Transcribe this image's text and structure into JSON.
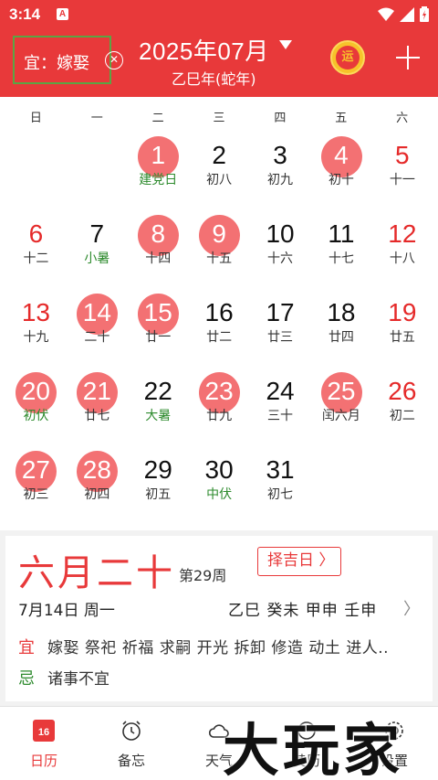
{
  "status_bar": {
    "time": "3:14",
    "app_badge": "A"
  },
  "header": {
    "yi_label": "宜：嫁娶",
    "month_title": "2025年07月",
    "year_subtitle": "乙巳年(蛇年)",
    "yun_label": "运"
  },
  "calendar": {
    "weekdays": [
      "日",
      "一",
      "二",
      "三",
      "四",
      "五",
      "六"
    ],
    "days": [
      {
        "num": "1",
        "lunar": "建党日",
        "col": 2,
        "row": 0,
        "circled": true,
        "red": false,
        "green": true
      },
      {
        "num": "2",
        "lunar": "初八",
        "col": 3,
        "row": 0,
        "circled": false,
        "red": false,
        "green": false
      },
      {
        "num": "3",
        "lunar": "初九",
        "col": 4,
        "row": 0,
        "circled": false,
        "red": false,
        "green": false
      },
      {
        "num": "4",
        "lunar": "初十",
        "col": 5,
        "row": 0,
        "circled": true,
        "red": false,
        "green": false
      },
      {
        "num": "5",
        "lunar": "十一",
        "col": 6,
        "row": 0,
        "circled": false,
        "red": true,
        "green": false
      },
      {
        "num": "6",
        "lunar": "十二",
        "col": 0,
        "row": 1,
        "circled": false,
        "red": true,
        "green": false
      },
      {
        "num": "7",
        "lunar": "小暑",
        "col": 1,
        "row": 1,
        "circled": false,
        "red": false,
        "green": true
      },
      {
        "num": "8",
        "lunar": "十四",
        "col": 2,
        "row": 1,
        "circled": true,
        "red": false,
        "green": false
      },
      {
        "num": "9",
        "lunar": "十五",
        "col": 3,
        "row": 1,
        "circled": true,
        "red": false,
        "green": false
      },
      {
        "num": "10",
        "lunar": "十六",
        "col": 4,
        "row": 1,
        "circled": false,
        "red": false,
        "green": false
      },
      {
        "num": "11",
        "lunar": "十七",
        "col": 5,
        "row": 1,
        "circled": false,
        "red": false,
        "green": false
      },
      {
        "num": "12",
        "lunar": "十八",
        "col": 6,
        "row": 1,
        "circled": false,
        "red": true,
        "green": false
      },
      {
        "num": "13",
        "lunar": "十九",
        "col": 0,
        "row": 2,
        "circled": false,
        "red": true,
        "green": false
      },
      {
        "num": "14",
        "lunar": "二十",
        "col": 1,
        "row": 2,
        "circled": true,
        "red": false,
        "green": false
      },
      {
        "num": "15",
        "lunar": "廿一",
        "col": 2,
        "row": 2,
        "circled": true,
        "red": false,
        "green": false
      },
      {
        "num": "16",
        "lunar": "廿二",
        "col": 3,
        "row": 2,
        "circled": false,
        "red": false,
        "green": false
      },
      {
        "num": "17",
        "lunar": "廿三",
        "col": 4,
        "row": 2,
        "circled": false,
        "red": false,
        "green": false
      },
      {
        "num": "18",
        "lunar": "廿四",
        "col": 5,
        "row": 2,
        "circled": false,
        "red": false,
        "green": false
      },
      {
        "num": "19",
        "lunar": "廿五",
        "col": 6,
        "row": 2,
        "circled": false,
        "red": true,
        "green": false
      },
      {
        "num": "20",
        "lunar": "初伏",
        "col": 0,
        "row": 3,
        "circled": true,
        "red": false,
        "green": true
      },
      {
        "num": "21",
        "lunar": "廿七",
        "col": 1,
        "row": 3,
        "circled": true,
        "red": false,
        "green": false
      },
      {
        "num": "22",
        "lunar": "大暑",
        "col": 2,
        "row": 3,
        "circled": false,
        "red": false,
        "green": true
      },
      {
        "num": "23",
        "lunar": "廿九",
        "col": 3,
        "row": 3,
        "circled": true,
        "red": false,
        "green": false
      },
      {
        "num": "24",
        "lunar": "三十",
        "col": 4,
        "row": 3,
        "circled": false,
        "red": false,
        "green": false
      },
      {
        "num": "25",
        "lunar": "闰六月",
        "col": 5,
        "row": 3,
        "circled": true,
        "red": false,
        "green": false
      },
      {
        "num": "26",
        "lunar": "初二",
        "col": 6,
        "row": 3,
        "circled": false,
        "red": true,
        "green": false
      },
      {
        "num": "27",
        "lunar": "初三",
        "col": 0,
        "row": 4,
        "circled": true,
        "red": false,
        "green": false
      },
      {
        "num": "28",
        "lunar": "初四",
        "col": 1,
        "row": 4,
        "circled": true,
        "red": false,
        "green": false
      },
      {
        "num": "29",
        "lunar": "初五",
        "col": 2,
        "row": 4,
        "circled": false,
        "red": false,
        "green": false
      },
      {
        "num": "30",
        "lunar": "中伏",
        "col": 3,
        "row": 4,
        "circled": false,
        "red": false,
        "green": true
      },
      {
        "num": "31",
        "lunar": "初七",
        "col": 4,
        "row": 4,
        "circled": false,
        "red": false,
        "green": false
      }
    ]
  },
  "detail": {
    "lunar_big": "六月二十",
    "week_number": "第29周",
    "zeji_label": "择吉日 〉",
    "solar_date": "7月14日 周一",
    "ganzhi": "乙巳  癸未  甲申  壬申",
    "yi_label": "宜",
    "yi_items": "嫁娶 祭祀 祈福 求嗣 开光 拆卸 修造 动土 进人..",
    "ji_label": "忌",
    "ji_items": "诸事不宜"
  },
  "nav": {
    "items": [
      {
        "label": "日历",
        "icon": "calendar-icon",
        "active": true
      },
      {
        "label": "备忘",
        "icon": "alarm-clock-icon",
        "active": false
      },
      {
        "label": "天气",
        "icon": "cloud-icon",
        "active": false
      },
      {
        "label": "黄历",
        "icon": "almanac-icon",
        "active": false
      },
      {
        "label": "设置",
        "icon": "settings-icon",
        "active": false
      }
    ],
    "calendar_icon_day": "16"
  },
  "watermark": "大玩家",
  "colors": {
    "primary": "#e8393a",
    "circle": "#f37173",
    "green": "#2e8b2e"
  }
}
